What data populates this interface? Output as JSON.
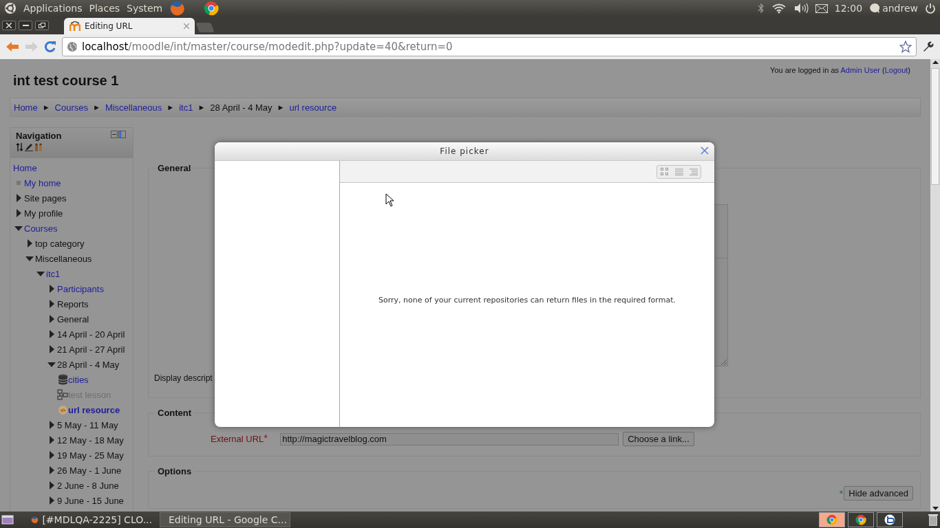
{
  "top_panel": {
    "menus": [
      "Applications",
      "Places",
      "System"
    ],
    "clock": "12:00",
    "user": "andrew"
  },
  "browser": {
    "tabs": [
      {
        "title": "Editing URL",
        "selected": true
      }
    ],
    "address": {
      "host": "localhost",
      "path": "/moodle/int/master/course/modedit.php?update=40&return=0"
    }
  },
  "page": {
    "course_title": "int test course 1",
    "login": {
      "prefix": "You are logged in as",
      "user": "Admin User",
      "before": "(",
      "logout": "Logout",
      "after": ")"
    },
    "breadcrumb": [
      {
        "label": "Home",
        "link": true
      },
      {
        "sep": "►",
        "label": "Courses",
        "link": true
      },
      {
        "sep": "►",
        "label": "Miscellaneous",
        "link": true
      },
      {
        "sep": "►",
        "label": "itc1",
        "link": true
      },
      {
        "sep": "►",
        "label": "28 April - 4 May",
        "link": false
      },
      {
        "sep": "►",
        "label": "url resource",
        "link": true
      }
    ],
    "navigation": {
      "title": "Navigation",
      "items": [
        {
          "label": "Home",
          "kind": "plain",
          "link": true
        },
        {
          "label": "My home",
          "kind": "bullet",
          "link": true
        },
        {
          "label": "Site pages",
          "kind": "branch",
          "link": false,
          "expanded": false
        },
        {
          "label": "My profile",
          "kind": "branch",
          "link": false,
          "expanded": false
        },
        {
          "label": "Courses",
          "kind": "branch",
          "link": true,
          "expanded": true,
          "children": [
            {
              "label": "top category",
              "kind": "branch",
              "link": false,
              "expanded": false
            },
            {
              "label": "Miscellaneous",
              "kind": "branch",
              "link": false,
              "expanded": true,
              "children": [
                {
                  "label": "itc1",
                  "kind": "branch",
                  "link": true,
                  "expanded": true,
                  "children": [
                    {
                      "label": "Participants",
                      "kind": "branch",
                      "link": true,
                      "expanded": false
                    },
                    {
                      "label": "Reports",
                      "kind": "branch",
                      "link": false,
                      "expanded": false
                    },
                    {
                      "label": "General",
                      "kind": "branch",
                      "link": false,
                      "expanded": false
                    },
                    {
                      "label": "14 April - 20 April",
                      "kind": "branch",
                      "link": false,
                      "expanded": false
                    },
                    {
                      "label": "21 April - 27 April",
                      "kind": "branch",
                      "link": false,
                      "expanded": false
                    },
                    {
                      "label": "28 April - 4 May",
                      "kind": "branch",
                      "link": false,
                      "expanded": true,
                      "children": [
                        {
                          "label": "cities",
                          "kind": "database",
                          "link": true,
                          "dimmed": false,
                          "current": false
                        },
                        {
                          "label": "test lesson",
                          "kind": "lesson",
                          "link": true,
                          "dimmed": true,
                          "current": false
                        },
                        {
                          "label": "url resource",
                          "kind": "url",
                          "link": true,
                          "dimmed": false,
                          "current": true
                        }
                      ]
                    },
                    {
                      "label": "5 May - 11 May",
                      "kind": "branch",
                      "link": false,
                      "expanded": false
                    },
                    {
                      "label": "12 May - 18 May",
                      "kind": "branch",
                      "link": false,
                      "expanded": false
                    },
                    {
                      "label": "19 May - 25 May",
                      "kind": "branch",
                      "link": false,
                      "expanded": false
                    },
                    {
                      "label": "26 May - 1 June",
                      "kind": "branch",
                      "link": false,
                      "expanded": false
                    },
                    {
                      "label": "2 June - 8 June",
                      "kind": "branch",
                      "link": false,
                      "expanded": false
                    },
                    {
                      "label": "9 June - 15 June",
                      "kind": "branch",
                      "link": false,
                      "expanded": false
                    }
                  ]
                }
              ]
            }
          ]
        }
      ]
    },
    "form": {
      "general": {
        "legend": "General",
        "display_label": "Display descript"
      },
      "content": {
        "legend": "Content",
        "url_label": "External URL",
        "required": "*",
        "url_value": "http://magictravelblog.com",
        "choose_button": "Choose a link..."
      },
      "options": {
        "legend": "Options",
        "advanced_marker": "*",
        "advanced_button": "Hide advanced"
      }
    }
  },
  "file_picker": {
    "title": "File picker",
    "message": "Sorry, none of your current repositories can return files in the required format."
  },
  "taskbar": {
    "windows": [
      {
        "title": "[#MDLQA-2225] CLO...",
        "kind": "firefox",
        "selected": false
      },
      {
        "title": "Editing URL - Google C...",
        "kind": "chrome",
        "selected": true
      }
    ],
    "tray": [
      {
        "kind": "chrome",
        "selected": true
      },
      {
        "kind": "chrome",
        "selected": false
      },
      {
        "kind": "other",
        "selected": false
      }
    ]
  }
}
